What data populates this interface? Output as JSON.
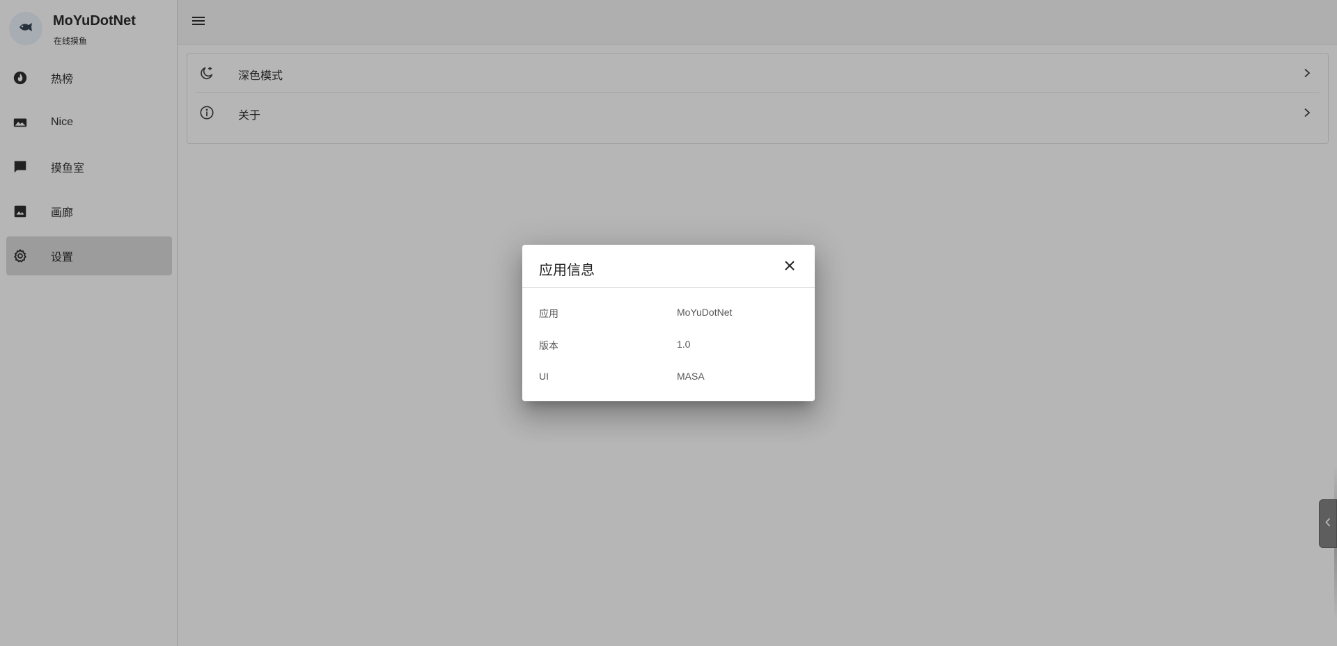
{
  "brand": {
    "title": "MoYuDotNet",
    "subtitle": "在线摸鱼",
    "icon": "fish-icon"
  },
  "sidebar": {
    "items": [
      {
        "label": "热榜",
        "icon": "fire-icon",
        "active": false
      },
      {
        "label": "Nice",
        "icon": "image-landscape-icon",
        "active": false
      },
      {
        "label": "摸鱼室",
        "icon": "chat-bubble-icon",
        "active": false
      },
      {
        "label": "画廊",
        "icon": "image-icon",
        "active": false
      },
      {
        "label": "设置",
        "icon": "gear-icon",
        "active": true
      }
    ]
  },
  "topbar": {
    "menu_icon": "menu-icon"
  },
  "settings": {
    "items": [
      {
        "label": "深色模式",
        "icon": "moon-star-icon"
      },
      {
        "label": "关于",
        "icon": "info-circle-icon"
      }
    ]
  },
  "dialog": {
    "title": "应用信息",
    "rows": [
      {
        "key": "应用",
        "value": "MoYuDotNet"
      },
      {
        "key": "版本",
        "value": "1.0"
      },
      {
        "key": "UI",
        "value": "MASA"
      }
    ]
  },
  "colors": {
    "accent_active_bg": "#d8d8d8",
    "scrim": "rgba(33,33,33,0.33)",
    "avatar_bg": "#eaf2fb"
  }
}
